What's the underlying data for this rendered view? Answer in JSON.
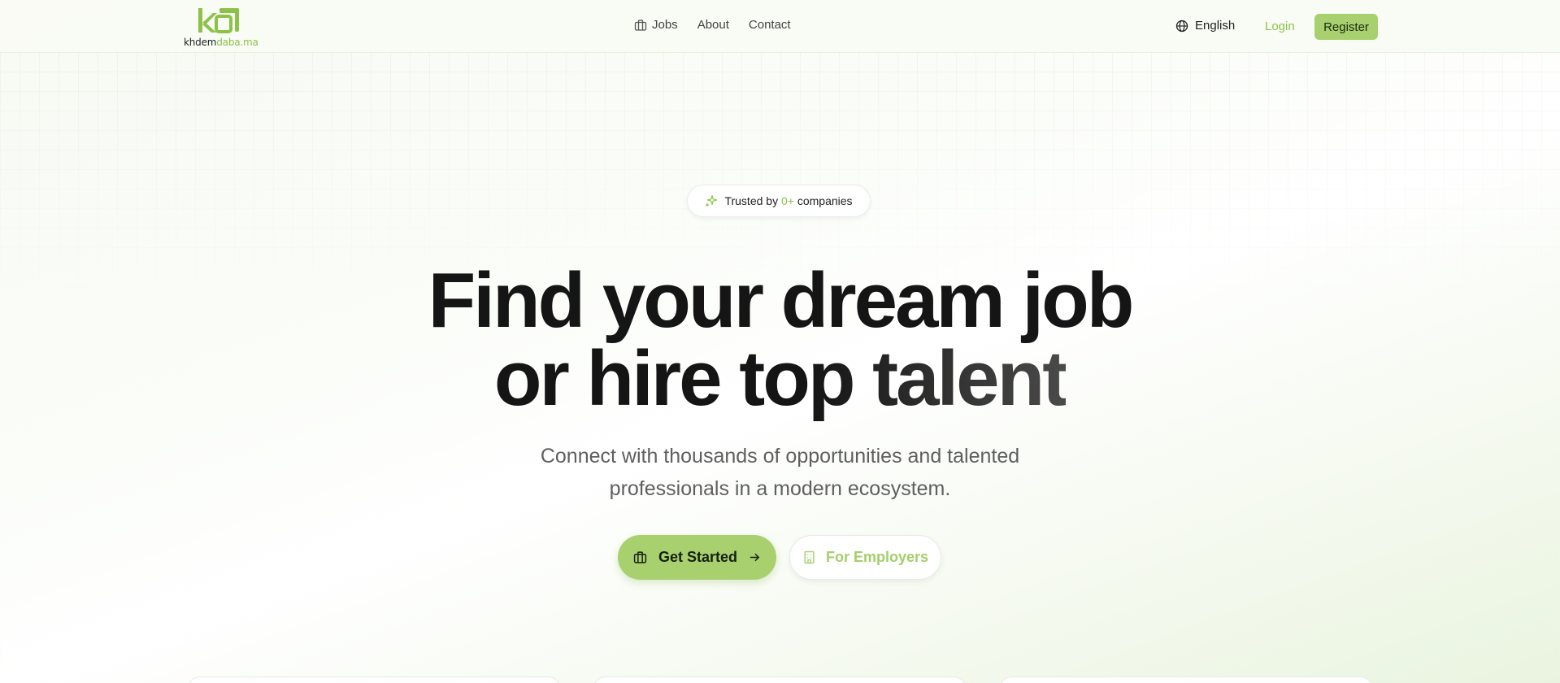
{
  "header": {
    "logo": {
      "mark_text": "k8",
      "name_dark": "khdem",
      "name_green": "daba.ma"
    },
    "nav": [
      {
        "label": "Jobs",
        "icon": "briefcase-icon"
      },
      {
        "label": "About"
      },
      {
        "label": "Contact"
      }
    ],
    "language": {
      "label": "English",
      "icon": "globe-icon"
    },
    "login_label": "Login",
    "register_label": "Register"
  },
  "hero": {
    "badge": {
      "prefix": "Trusted by",
      "count": "0+",
      "suffix": "companies",
      "icon": "sparkles-icon"
    },
    "headline_line1": "Find your dream job",
    "headline_line2": "or hire top talent",
    "subtitle_line1": "Connect with thousands of opportunities and talented",
    "subtitle_line2": "professionals in a modern ecosystem.",
    "primary_cta": {
      "label": "Get Started",
      "icon": "briefcase-icon",
      "trailing_icon": "arrow-right-icon"
    },
    "secondary_cta": {
      "label": "For Employers",
      "icon": "building-icon"
    }
  },
  "colors": {
    "accent": "#a8d06e",
    "accent_text": "#8dc24a",
    "heading": "#151515",
    "muted": "#5f5f5f"
  }
}
